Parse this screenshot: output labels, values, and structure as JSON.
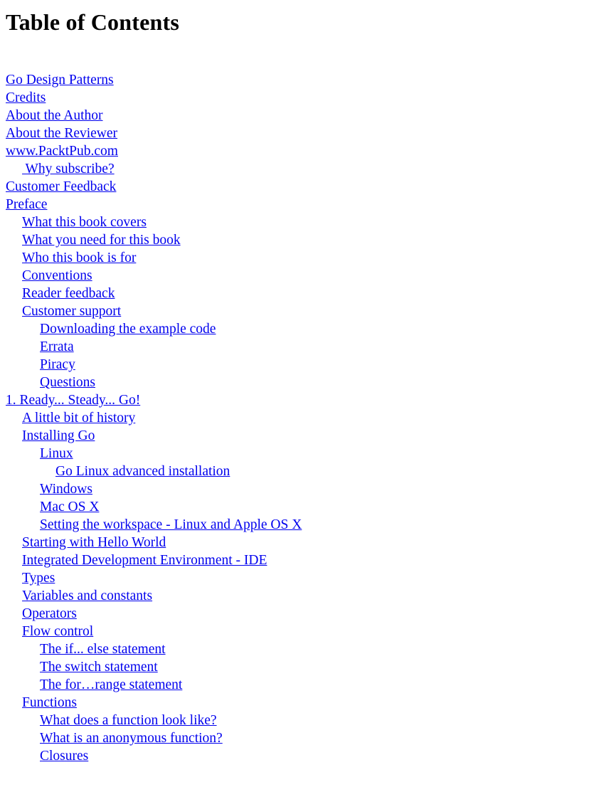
{
  "document": {
    "title": "Table of Contents",
    "link_color": "#0000ee",
    "text_color": "#000000",
    "background_color": "#ffffff"
  },
  "toc": {
    "entries": [
      {
        "label": "Go Design Patterns",
        "level": 0
      },
      {
        "label": "Credits",
        "level": 0
      },
      {
        "label": "About the Author",
        "level": 0
      },
      {
        "label": "About the Reviewer",
        "level": 0
      },
      {
        "label": "www.PacktPub.com",
        "level": 0
      },
      {
        "label": " Why subscribe?",
        "level": 1
      },
      {
        "label": "Customer Feedback",
        "level": 0
      },
      {
        "label": "Preface",
        "level": 0
      },
      {
        "label": "What this book covers",
        "level": 1
      },
      {
        "label": "What you need for this book",
        "level": 1
      },
      {
        "label": "Who this book is for",
        "level": 1
      },
      {
        "label": "Conventions",
        "level": 1
      },
      {
        "label": "Reader feedback",
        "level": 1
      },
      {
        "label": "Customer support",
        "level": 1
      },
      {
        "label": "Downloading the example code",
        "level": 2
      },
      {
        "label": "Errata",
        "level": 2
      },
      {
        "label": "Piracy",
        "level": 2
      },
      {
        "label": "Questions",
        "level": 2
      },
      {
        "label": "1. Ready... Steady... Go!",
        "level": 0
      },
      {
        "label": "A little bit of history",
        "level": 1
      },
      {
        "label": "Installing Go",
        "level": 1
      },
      {
        "label": "Linux",
        "level": 2
      },
      {
        "label": "Go Linux advanced installation",
        "level": 3
      },
      {
        "label": "Windows",
        "level": 2
      },
      {
        "label": "Mac OS X",
        "level": 2
      },
      {
        "label": "Setting the workspace - Linux and Apple OS X",
        "level": 2
      },
      {
        "label": "Starting with Hello World",
        "level": 1
      },
      {
        "label": "Integrated Development Environment - IDE",
        "level": 1
      },
      {
        "label": "Types",
        "level": 1
      },
      {
        "label": "Variables and constants",
        "level": 1
      },
      {
        "label": "Operators",
        "level": 1
      },
      {
        "label": "Flow control",
        "level": 1
      },
      {
        "label": "The if... else statement",
        "level": 2
      },
      {
        "label": "The switch statement",
        "level": 2
      },
      {
        "label": "The for…range statement",
        "level": 2
      },
      {
        "label": "Functions",
        "level": 1
      },
      {
        "label": "What does a function look like?",
        "level": 2
      },
      {
        "label": "What is an anonymous function?",
        "level": 2
      },
      {
        "label": "Closures",
        "level": 2
      }
    ]
  }
}
